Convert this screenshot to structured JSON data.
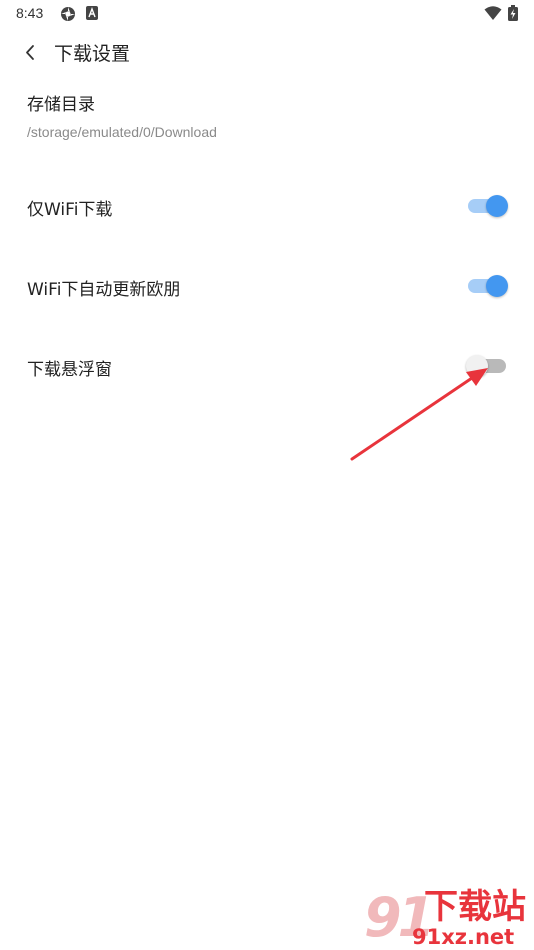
{
  "status_bar": {
    "time": "8:43",
    "icons": [
      "app-notification-icon",
      "a-badge-icon",
      "wifi-icon",
      "battery-charging-icon"
    ]
  },
  "header": {
    "title": "下载设置",
    "back_icon": "chevron-left-icon"
  },
  "storage": {
    "title": "存储目录",
    "path": "/storage/emulated/0/Download"
  },
  "settings": [
    {
      "label": "仅WiFi下载",
      "enabled": true
    },
    {
      "label": "WiFi下自动更新欧朋",
      "enabled": true
    },
    {
      "label": "下载悬浮窗",
      "enabled": false
    }
  ],
  "colors": {
    "accent": "#4397f0",
    "accent_track": "#a6cdf7",
    "off_track": "#b9b9b9",
    "off_knob": "#f1f1f1",
    "annotation_arrow": "#e8343c"
  },
  "watermark": {
    "number": "91",
    "title": "下载站",
    "domain": "91xz.net"
  }
}
